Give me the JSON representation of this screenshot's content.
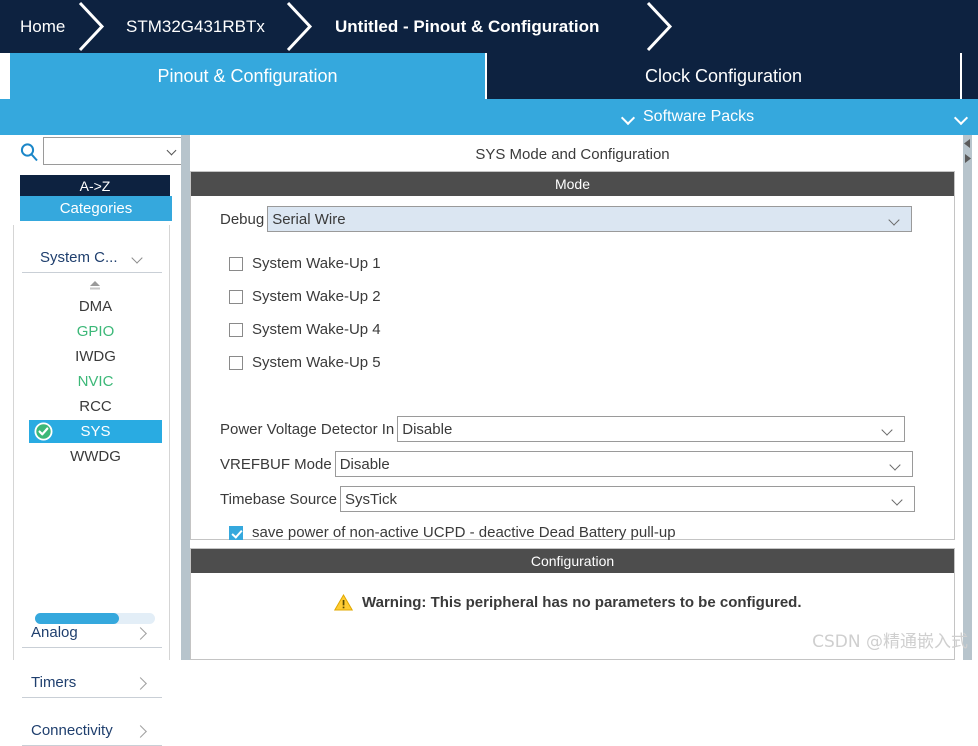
{
  "breadcrumb": {
    "items": [
      {
        "label": "Home",
        "active": false
      },
      {
        "label": "STM32G431RBTx",
        "active": false
      },
      {
        "label": "Untitled - Pinout & Configuration",
        "active": true
      }
    ],
    "background": "#0d2240",
    "text_color": "#ffffff"
  },
  "tabs": {
    "items": [
      {
        "label": "Pinout & Configuration",
        "selected": true
      },
      {
        "label": "Clock Configuration",
        "selected": false
      },
      {
        "label": "",
        "selected": false
      }
    ],
    "selected_color": "#35a8dd",
    "unselected_color": "#0d2240"
  },
  "software_packs_row": {
    "label": "Software Packs",
    "background": "#35a8dd"
  },
  "sidebar": {
    "search": {
      "value": "",
      "placeholder": "",
      "icon": "search-icon"
    },
    "mode_tabs": [
      {
        "label": "A->Z",
        "selected": false
      },
      {
        "label": "Categories",
        "selected": true
      }
    ],
    "groups": [
      {
        "label": "System C...",
        "expanded": true,
        "items": [
          {
            "label": "DMA",
            "state": "normal",
            "selected": false
          },
          {
            "label": "GPIO",
            "state": "green",
            "selected": false
          },
          {
            "label": "IWDG",
            "state": "normal",
            "selected": false
          },
          {
            "label": "NVIC",
            "state": "green",
            "selected": false
          },
          {
            "label": "RCC",
            "state": "normal",
            "selected": false
          },
          {
            "label": "SYS",
            "state": "normal",
            "selected": true
          },
          {
            "label": "WWDG",
            "state": "normal",
            "selected": false
          }
        ]
      },
      {
        "label": "Analog",
        "expanded": false,
        "items": []
      },
      {
        "label": "Timers",
        "expanded": false,
        "items": []
      },
      {
        "label": "Connectivity",
        "expanded": false,
        "items": []
      }
    ],
    "scrollbar": {
      "thumb_percent": 70,
      "thumb_color": "#35a8dd",
      "track_color": "#e3eef7"
    },
    "selected_color": "#29abe2",
    "green_color": "#3cb878"
  },
  "main": {
    "title": "SYS Mode and Configuration",
    "mode_section": {
      "header": "Mode",
      "debug": {
        "label": "Debug",
        "value": "Serial Wire",
        "highlighted": true
      },
      "checkboxes": [
        {
          "label": "System Wake-Up 1",
          "checked": false
        },
        {
          "label": "System Wake-Up 2",
          "checked": false
        },
        {
          "label": "System Wake-Up 4",
          "checked": false
        },
        {
          "label": "System Wake-Up 5",
          "checked": false
        }
      ],
      "dropdowns": [
        {
          "label": "Power Voltage Detector In",
          "value": "Disable"
        },
        {
          "label": "VREFBUF Mode",
          "value": "Disable"
        },
        {
          "label": "Timebase Source",
          "value": "SysTick"
        }
      ],
      "ucpd_checkbox": {
        "label": "save power of non-active UCPD - deactive Dead Battery pull-up",
        "checked": true
      }
    },
    "config_section": {
      "header": "Configuration",
      "warning": "Warning: This peripheral has no parameters to be configured."
    }
  },
  "watermark": "CSDN @精通嵌入式"
}
